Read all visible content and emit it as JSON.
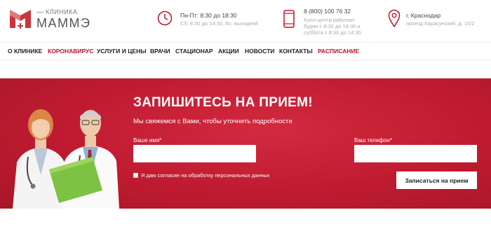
{
  "brand": {
    "small_label": "КЛИНИКА",
    "name": "МАММЭ"
  },
  "header": {
    "hours": {
      "main": "Пн-Пт: 8:30 до 18:30",
      "sub": "Сб: 8:30 до 14:30, Вс: выходной"
    },
    "phone": {
      "main": "8 (800) 100 76 32",
      "sub1": "Колл-центр работает",
      "sub2": "будни с 8:30 до 18:30 и",
      "sub3": "суббота с 8:30 до 14:30"
    },
    "address": {
      "main": "г. Краснодар",
      "sub": "проезд Карасунский, д. 15/2"
    }
  },
  "nav": {
    "items": [
      {
        "label": "О КЛИНИКЕ"
      },
      {
        "label": "КОРОНАВИРУС"
      },
      {
        "label": "УСЛУГИ И ЦЕНЫ"
      },
      {
        "label": "ВРАЧИ"
      },
      {
        "label": "СТАЦИОНАР"
      },
      {
        "label": "АКЦИИ"
      },
      {
        "label": "НОВОСТИ"
      },
      {
        "label": "КОНТАКТЫ"
      },
      {
        "label": "РАСПИСАНИЕ"
      }
    ]
  },
  "form": {
    "title": "ЗАПИШИТЕСЬ НА ПРИЕМ!",
    "subtitle": "Мы свяжемся с Вами, чтобы уточнить подробности",
    "name_label": "Ваше имя*",
    "name_value": "",
    "phone_label": "Ваш телефон*",
    "phone_value": "",
    "consent": "Я даю согласие на обработку персональных данных",
    "submit": "Записаться на прием"
  },
  "colors": {
    "accent": "#c0142c",
    "banner": "#bf1b30"
  }
}
